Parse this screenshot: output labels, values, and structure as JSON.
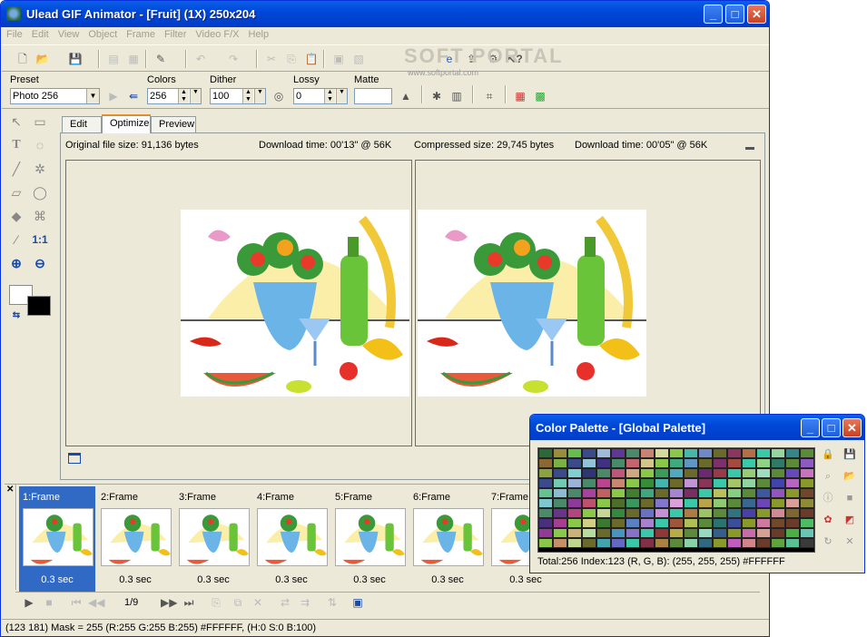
{
  "window": {
    "title": "Ulead GIF Animator - [Fruit] (1X) 250x204"
  },
  "menu": [
    "File",
    "Edit",
    "View",
    "Object",
    "Frame",
    "Filter",
    "Video F/X",
    "Help"
  ],
  "logo": {
    "text": "SOFT PORTAL",
    "sub": "www.softportal.com"
  },
  "options": {
    "preset_label": "Preset",
    "preset_value": "Photo 256",
    "colors_label": "Colors",
    "colors_value": "256",
    "dither_label": "Dither",
    "dither_value": "100",
    "lossy_label": "Lossy",
    "lossy_value": "0",
    "matte_label": "Matte"
  },
  "tabs": [
    "Edit",
    "Optimize",
    "Preview"
  ],
  "info": {
    "original": "Original file size:   91,136 bytes",
    "download1": "Download time:   00'13\" @ 56K",
    "compressed": "Compressed size: 29,745 bytes",
    "download2": "Download time:   00'05\" @ 56K"
  },
  "frames": [
    {
      "label": "1:Frame",
      "sec": "0.3 sec"
    },
    {
      "label": "2:Frame",
      "sec": "0.3 sec"
    },
    {
      "label": "3:Frame",
      "sec": "0.3 sec"
    },
    {
      "label": "4:Frame",
      "sec": "0.3 sec"
    },
    {
      "label": "5:Frame",
      "sec": "0.3 sec"
    },
    {
      "label": "6:Frame",
      "sec": "0.3 sec"
    },
    {
      "label": "7:Frame",
      "sec": "0.3 sec"
    }
  ],
  "playbar": {
    "counter": "1/9"
  },
  "status": "(123 181) Mask = 255 (R:255 G:255 B:255) #FFFFFF, (H:0 S:0 B:100)",
  "palette": {
    "title": "Color Palette - [Global Palette]",
    "info": "Total:256  Index:123  (R, G, B): (255, 255, 255) #FFFFFF"
  },
  "colors": {
    "accent": "#0a5fe8",
    "selected": "#316ac5",
    "bg": "#ece9d8"
  }
}
